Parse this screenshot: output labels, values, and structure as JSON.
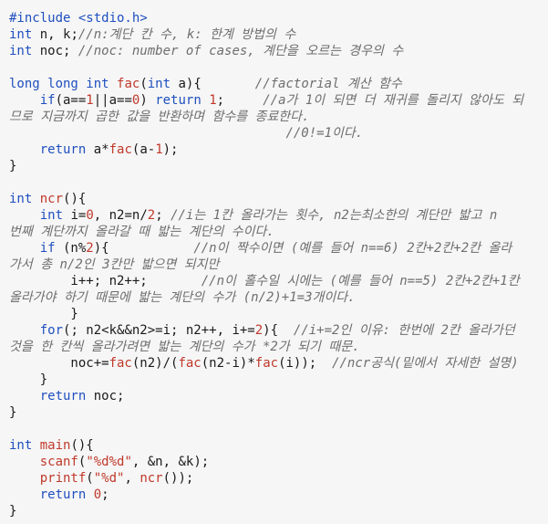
{
  "code_lines": [
    [
      [
        "pre",
        "#include <stdio.h>"
      ]
    ],
    [
      [
        "kw",
        "int"
      ],
      [
        "p",
        " n, k;"
      ],
      [
        "cmt",
        "//n:계단 칸 수, k: 한계 방법의 수"
      ]
    ],
    [
      [
        "kw",
        "int"
      ],
      [
        "p",
        " noc; "
      ],
      [
        "cmt",
        "//noc: number of cases, 계단을 오르는 경우의 수"
      ]
    ],
    [],
    [
      [
        "kw",
        "long long int"
      ],
      [
        "p",
        " "
      ],
      [
        "fn",
        "fac"
      ],
      [
        "p",
        "("
      ],
      [
        "kw",
        "int"
      ],
      [
        "p",
        " a){       "
      ],
      [
        "cmt",
        "//factorial 계산 함수"
      ]
    ],
    [
      [
        "p",
        "    "
      ],
      [
        "kw",
        "if"
      ],
      [
        "p",
        "(a=="
      ],
      [
        "num",
        "1"
      ],
      [
        "p",
        "||a=="
      ],
      [
        "num",
        "0"
      ],
      [
        "p",
        ") "
      ],
      [
        "kw",
        "return"
      ],
      [
        "p",
        " "
      ],
      [
        "num",
        "1"
      ],
      [
        "p",
        ";     "
      ],
      [
        "cmt",
        "//a가 1이 되면 더 재귀를 돌리지 않아도 되"
      ]
    ],
    [
      [
        "cmt",
        "므로 지금까지 곱한 값을 반환하며 함수를 종료한다."
      ]
    ],
    [
      [
        "p",
        "                                    "
      ],
      [
        "cmt",
        "//0!=1이다."
      ]
    ],
    [
      [
        "p",
        "    "
      ],
      [
        "kw",
        "return"
      ],
      [
        "p",
        " a*"
      ],
      [
        "fn",
        "fac"
      ],
      [
        "p",
        "(a-"
      ],
      [
        "num",
        "1"
      ],
      [
        "p",
        ");"
      ]
    ],
    [
      [
        "p",
        "}"
      ]
    ],
    [],
    [
      [
        "kw",
        "int"
      ],
      [
        "p",
        " "
      ],
      [
        "fn",
        "ncr"
      ],
      [
        "p",
        "(){"
      ]
    ],
    [
      [
        "p",
        "    "
      ],
      [
        "kw",
        "int"
      ],
      [
        "p",
        " i="
      ],
      [
        "num",
        "0"
      ],
      [
        "p",
        ", n2=n/"
      ],
      [
        "num",
        "2"
      ],
      [
        "p",
        "; "
      ],
      [
        "cmt",
        "//i는 1칸 올라가는 횟수, n2는최소한의 계단만 밟고 n"
      ]
    ],
    [
      [
        "cmt",
        "번째 계단까지 올라갈 때 밟는 계단의 수이다."
      ]
    ],
    [
      [
        "p",
        "    "
      ],
      [
        "kw",
        "if"
      ],
      [
        "p",
        " (n%"
      ],
      [
        "num",
        "2"
      ],
      [
        "p",
        "){           "
      ],
      [
        "cmt",
        "//n이 짝수이면 (예를 들어 n==6) 2칸+2칸+2칸 올라"
      ]
    ],
    [
      [
        "cmt",
        "가서 총 n/2인 3칸만 밟으면 되지만"
      ]
    ],
    [
      [
        "p",
        "        i++; n2++;       "
      ],
      [
        "cmt",
        "//n이 홀수일 시에는 (예를 들어 n==5) 2칸+2칸+1칸"
      ]
    ],
    [
      [
        "cmt",
        "올라가야 하기 때문에 밟는 계단의 수가 (n/2)+1=3개이다."
      ]
    ],
    [
      [
        "p",
        "        }"
      ]
    ],
    [
      [
        "p",
        "    "
      ],
      [
        "kw",
        "for"
      ],
      [
        "p",
        "(; n2<k&&n2>=i; n2++, i+="
      ],
      [
        "num",
        "2"
      ],
      [
        "p",
        "){  "
      ],
      [
        "cmt",
        "//i+=2인 이유: 한번에 2칸 올라가던"
      ]
    ],
    [
      [
        "cmt",
        "것을 한 칸씩 올라가려면 밟는 계단의 수가 *2가 되기 때문."
      ]
    ],
    [
      [
        "p",
        "        noc+="
      ],
      [
        "fn",
        "fac"
      ],
      [
        "p",
        "(n2)/("
      ],
      [
        "fn",
        "fac"
      ],
      [
        "p",
        "(n2-i)*"
      ],
      [
        "fn",
        "fac"
      ],
      [
        "p",
        "(i));  "
      ],
      [
        "cmt",
        "//ncr공식(밑에서 자세한 설명)"
      ]
    ],
    [
      [
        "p",
        "    }"
      ]
    ],
    [
      [
        "p",
        "    "
      ],
      [
        "kw",
        "return"
      ],
      [
        "p",
        " noc;"
      ]
    ],
    [
      [
        "p",
        "}"
      ]
    ],
    [],
    [
      [
        "kw",
        "int"
      ],
      [
        "p",
        " "
      ],
      [
        "fn",
        "main"
      ],
      [
        "p",
        "(){"
      ]
    ],
    [
      [
        "p",
        "    "
      ],
      [
        "fn",
        "scanf"
      ],
      [
        "p",
        "("
      ],
      [
        "str",
        "\"%d%d\""
      ],
      [
        "p",
        ", &n, &k);"
      ]
    ],
    [
      [
        "p",
        "    "
      ],
      [
        "fn",
        "printf"
      ],
      [
        "p",
        "("
      ],
      [
        "str",
        "\"%d\""
      ],
      [
        "p",
        ", "
      ],
      [
        "fn",
        "ncr"
      ],
      [
        "p",
        "());"
      ]
    ],
    [
      [
        "p",
        "    "
      ],
      [
        "kw",
        "return"
      ],
      [
        "p",
        " "
      ],
      [
        "num",
        "0"
      ],
      [
        "p",
        ";"
      ]
    ],
    [
      [
        "p",
        "}"
      ]
    ]
  ]
}
